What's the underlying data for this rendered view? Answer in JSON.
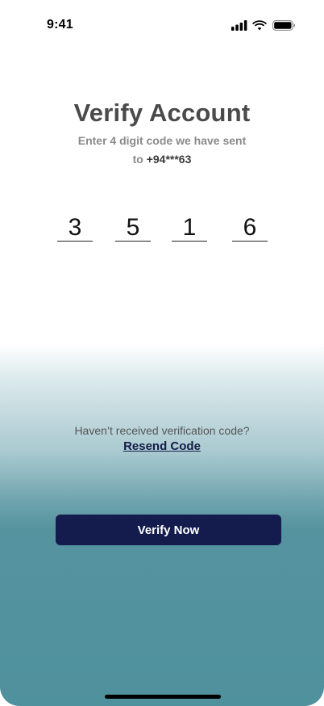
{
  "status_bar": {
    "time": "9:41",
    "icons": [
      "cellular-signal-icon",
      "wifi-icon",
      "battery-icon"
    ]
  },
  "header": {
    "title": "Verify Account",
    "subtitle_line1": "Enter 4 digit code we have sent",
    "subtitle_line2_prefix": "to ",
    "phone": "+94***63"
  },
  "code": {
    "digits": [
      "3",
      "5",
      "1",
      "6"
    ]
  },
  "resend": {
    "prompt": "Haven’t received verification code?",
    "link_label": "Resend Code"
  },
  "actions": {
    "verify_label": "Verify Now"
  },
  "colors": {
    "title": "#4a4a4a",
    "subtitle": "#8a8a8a",
    "button_bg": "#141c4d",
    "gradient_bottom": "#4f919d"
  }
}
